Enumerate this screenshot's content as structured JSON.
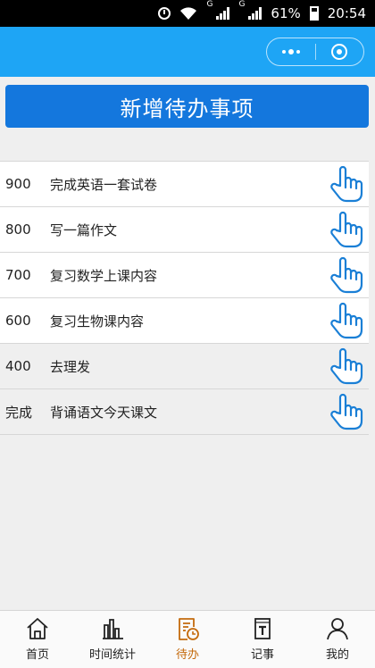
{
  "statusbar": {
    "signal_tag_1": "G",
    "signal_tag_2": "G",
    "battery": "61%",
    "time": "20:54"
  },
  "colors": {
    "titlebar": "#1ea5f5",
    "primary_button": "#1477dd",
    "hand_icon": "#1a7fd6",
    "active_tab": "#c46a0c"
  },
  "main": {
    "add_button_label": "新增待办事项",
    "todos": [
      {
        "priority": "900",
        "title": "完成英语一套试卷"
      },
      {
        "priority": "800",
        "title": "写一篇作文"
      },
      {
        "priority": "700",
        "title": "复习数学上课内容"
      },
      {
        "priority": "600",
        "title": "复习生物课内容"
      },
      {
        "priority": "400",
        "title": "去理发"
      },
      {
        "priority": "完成",
        "title": "背诵语文今天课文"
      }
    ]
  },
  "tabbar": {
    "tabs": [
      {
        "label": "首页",
        "icon": "home-icon"
      },
      {
        "label": "时间统计",
        "icon": "bar-chart-icon"
      },
      {
        "label": "待办",
        "icon": "todo-clock-icon",
        "active": true
      },
      {
        "label": "记事",
        "icon": "notebook-icon"
      },
      {
        "label": "我的",
        "icon": "person-icon"
      }
    ]
  }
}
